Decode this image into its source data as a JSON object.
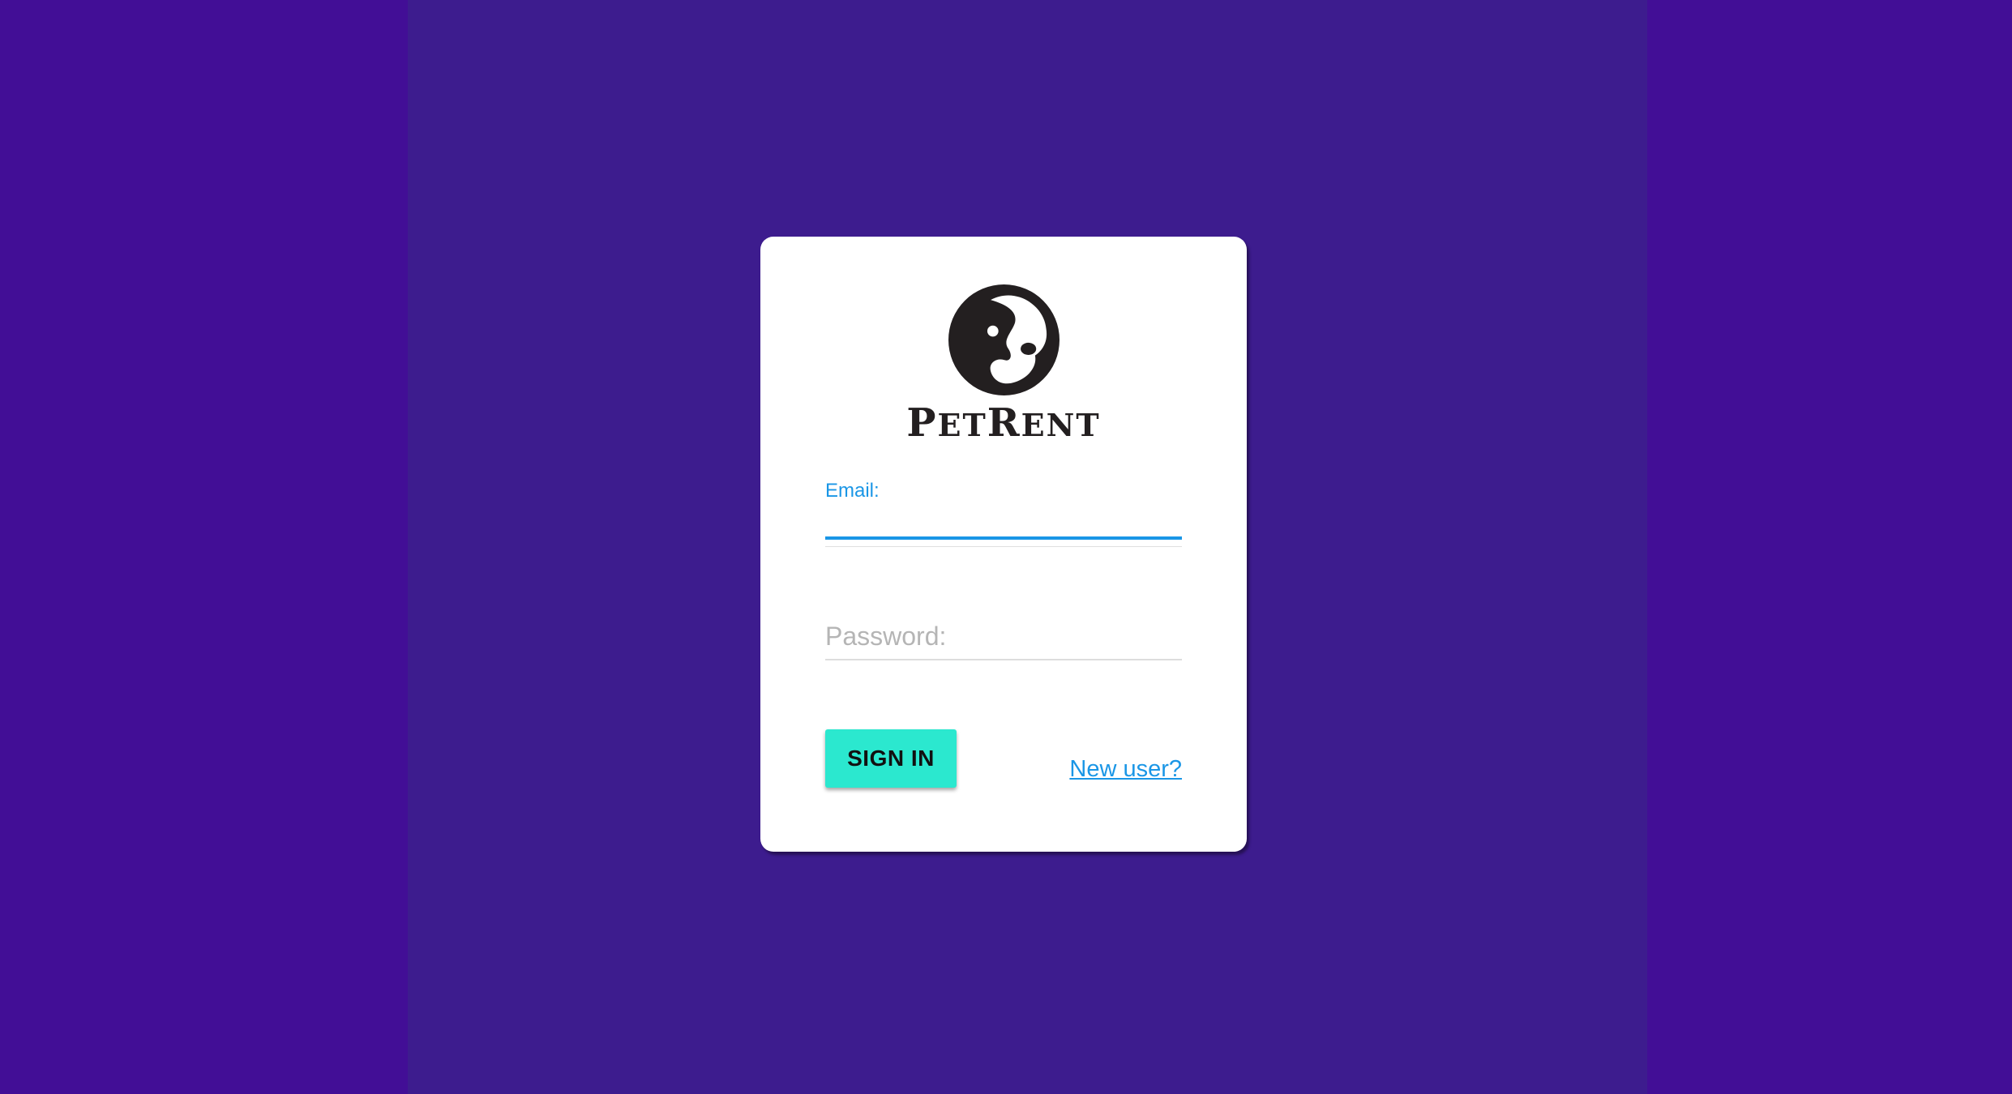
{
  "brand": {
    "logo_icon": "dog-logo-icon",
    "name_first_initial": "P",
    "name_first_rest": "ET",
    "name_second_initial": "R",
    "name_second_rest": "ENT"
  },
  "form": {
    "email_label": "Email:",
    "email_value": "",
    "password_placeholder": "Password:",
    "password_value": "",
    "signin_label": "SIGN IN",
    "new_user_label": "New user?"
  },
  "colors": {
    "background": "#420e96",
    "panel": "#3d1c8e",
    "card": "#ffffff",
    "accent_blue": "#1a96e6",
    "button": "#2be8cf"
  }
}
